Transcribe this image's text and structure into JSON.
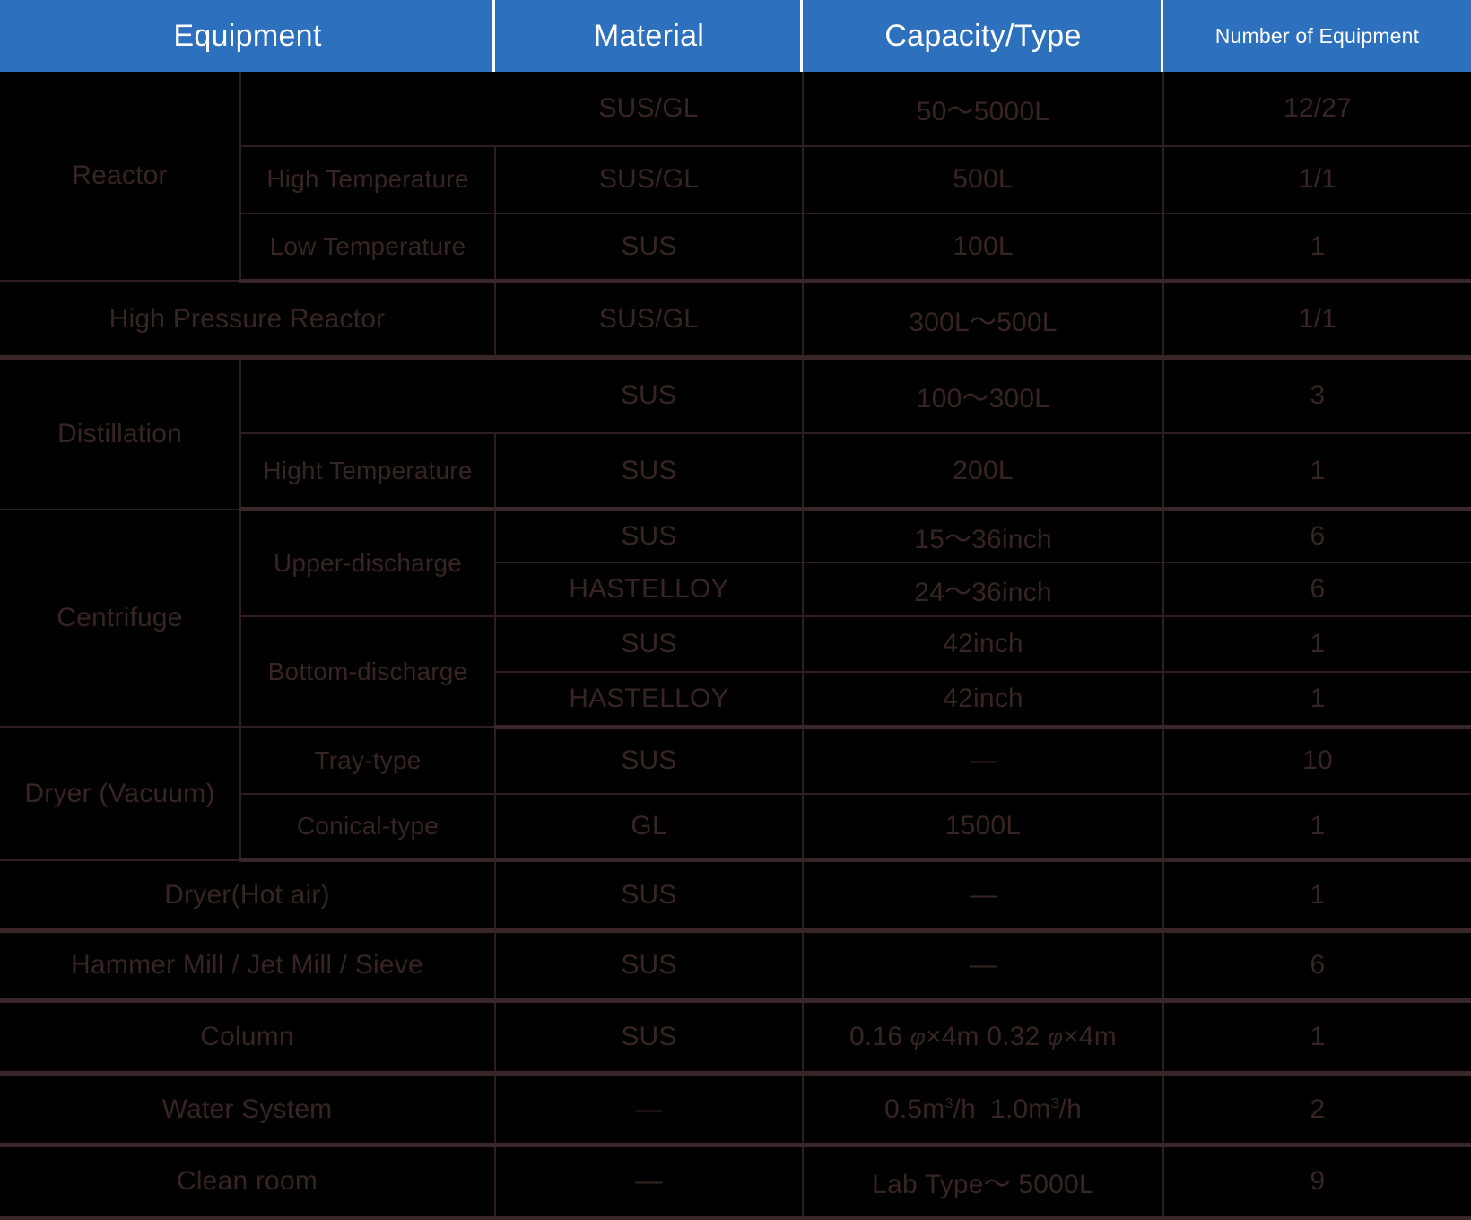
{
  "colors": {
    "header_background": "#2C70BE",
    "header_text": "#FFFFFF",
    "body_background": "#000000",
    "body_text": "#362522",
    "grid_line": "#2E1E1F"
  },
  "header": {
    "columns": [
      {
        "label": "Equipment",
        "size": "big"
      },
      {
        "label": "Material",
        "size": "big"
      },
      {
        "label": "Capacity/Type",
        "size": "big"
      },
      {
        "label": "Number of Equipment",
        "size": "small"
      }
    ]
  },
  "rows": [
    {
      "group": "Reactor",
      "sub": "",
      "material": "SUS/GL",
      "capacity": "50〜5000L",
      "count": "12/27"
    },
    {
      "group": "",
      "sub": "High Temperature",
      "material": "SUS/GL",
      "capacity": "500L",
      "count": "1/1"
    },
    {
      "group": "",
      "sub": "Low Temperature",
      "material": "SUS",
      "capacity": "100L",
      "count": "1"
    },
    {
      "group": "High Pressure Reactor",
      "sub": "",
      "material": "SUS/GL",
      "capacity": "300L〜500L",
      "count": "1/1"
    },
    {
      "group": "Distillation",
      "sub": "",
      "material": "SUS",
      "capacity": "100〜300L",
      "count": "3"
    },
    {
      "group": "",
      "sub": "Hight Temperature",
      "material": "SUS",
      "capacity": "200L",
      "count": "1"
    },
    {
      "group": "Centrifuge",
      "sub": "Upper-discharge",
      "material": "SUS",
      "capacity": "15〜36inch",
      "count": "6"
    },
    {
      "group": "",
      "sub": "",
      "material": "HASTELLOY",
      "capacity": "24〜36inch",
      "count": "6"
    },
    {
      "group": "",
      "sub": "Bottom-discharge",
      "material": "SUS",
      "capacity": "42inch",
      "count": "1"
    },
    {
      "group": "",
      "sub": "",
      "material": "HASTELLOY",
      "capacity": "42inch",
      "count": "1"
    },
    {
      "group": "Dryer (Vacuum)",
      "sub": "Tray-type",
      "material": "SUS",
      "capacity": "—",
      "count": "10"
    },
    {
      "group": "",
      "sub": "Conical-type",
      "material": "GL",
      "capacity": "1500L",
      "count": "1"
    },
    {
      "group": "Dryer(Hot air)",
      "sub": "",
      "material": "SUS",
      "capacity": "—",
      "count": "1"
    },
    {
      "group": "Hammer Mill / Jet Mill / Sieve",
      "sub": "",
      "material": "SUS",
      "capacity": "—",
      "count": "6"
    },
    {
      "group": "Column",
      "sub": "",
      "material": "SUS",
      "capacity": "0.16 φ×4m 0.32 φ×4m",
      "count": "1"
    },
    {
      "group": "Water System",
      "sub": "",
      "material": "—",
      "capacity": "0.5m³/h   1.0m³/h",
      "count": "2"
    },
    {
      "group": "Clean room",
      "sub": "",
      "material": "—",
      "capacity": "Lab Type〜 5000L",
      "count": "9"
    }
  ],
  "labels": {
    "reactor": "Reactor",
    "reactor_high_temp": "High Temperature",
    "reactor_low_temp": "Low Temperature",
    "high_pressure_reactor": "High Pressure Reactor",
    "distillation": "Distillation",
    "distillation_high_temp": "Hight Temperature",
    "centrifuge": "Centrifuge",
    "upper_discharge": "Upper-discharge",
    "bottom_discharge": "Bottom-discharge",
    "dryer_vacuum": "Dryer (Vacuum)",
    "tray_type": "Tray-type",
    "conical_type": "Conical-type",
    "dryer_hot_air": "Dryer(Hot air)",
    "hammer_mill": "Hammer Mill / Jet Mill / Sieve",
    "column": "Column",
    "water_system": "Water System",
    "clean_room": "Clean room"
  },
  "values": {
    "sus_gl": "SUS/GL",
    "sus": "SUS",
    "gl": "GL",
    "hastelloy": "HASTELLOY",
    "dash": "—",
    "cap_reactor": "50〜5000L",
    "cap_500l": "500L",
    "cap_100l": "100L",
    "cap_hp": "300L〜500L",
    "cap_100_300": "100〜300L",
    "cap_200l": "200L",
    "cap_15_36": "15〜36inch",
    "cap_24_36": "24〜36inch",
    "cap_42": "42inch",
    "cap_1500l": "1500L",
    "cap_lab": "Lab Type〜 5000L",
    "n_1227": "12/27",
    "n_11": "1/1",
    "n_1": "1",
    "n_3": "3",
    "n_6": "6",
    "n_10": "10",
    "n_2": "2",
    "n_9": "9"
  }
}
